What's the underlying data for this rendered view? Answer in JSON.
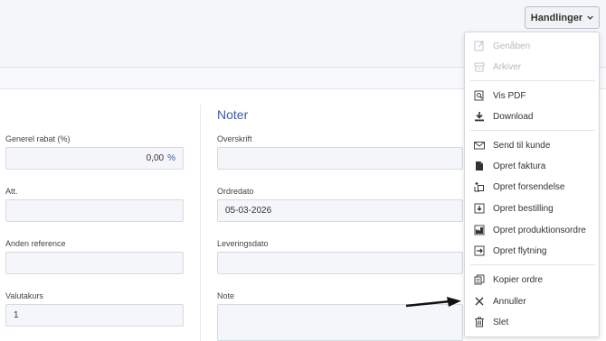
{
  "header": {
    "actions_label": "Handlinger"
  },
  "left_form": {
    "discount": {
      "label": "Generel rabat (%)",
      "value": "0,00",
      "unit": "%"
    },
    "att": {
      "label": "Att.",
      "value": ""
    },
    "other_ref": {
      "label": "Anden reference",
      "value": ""
    },
    "currency_rate": {
      "label": "Valutakurs",
      "value": "1"
    }
  },
  "notes": {
    "title": "Noter",
    "heading": {
      "label": "Overskrift",
      "value": ""
    },
    "order_date": {
      "label": "Ordredato",
      "value": "05-03-2026"
    },
    "delivery_date": {
      "label": "Leveringsdato",
      "value": ""
    },
    "note": {
      "label": "Note",
      "value": ""
    }
  },
  "menu": {
    "items": [
      {
        "label": "Genåben",
        "icon": "reopen-icon",
        "disabled": true
      },
      {
        "label": "Arkiver",
        "icon": "archive-icon",
        "disabled": true
      },
      {
        "label": "Vis PDF",
        "icon": "pdf-view-icon",
        "disabled": false
      },
      {
        "label": "Download",
        "icon": "download-icon",
        "disabled": false
      },
      {
        "label": "Send til kunde",
        "icon": "envelope-icon",
        "disabled": false
      },
      {
        "label": "Opret faktura",
        "icon": "invoice-icon",
        "disabled": false
      },
      {
        "label": "Opret forsendelse",
        "icon": "shipment-icon",
        "disabled": false
      },
      {
        "label": "Opret bestilling",
        "icon": "purchase-order-icon",
        "disabled": false
      },
      {
        "label": "Opret produktionsordre",
        "icon": "production-icon",
        "disabled": false
      },
      {
        "label": "Opret flytning",
        "icon": "transfer-icon",
        "disabled": false
      },
      {
        "label": "Kopier ordre",
        "icon": "copy-icon",
        "disabled": false
      },
      {
        "label": "Annuller",
        "icon": "close-icon",
        "disabled": false
      },
      {
        "label": "Slet",
        "icon": "trash-icon",
        "disabled": false
      }
    ]
  }
}
